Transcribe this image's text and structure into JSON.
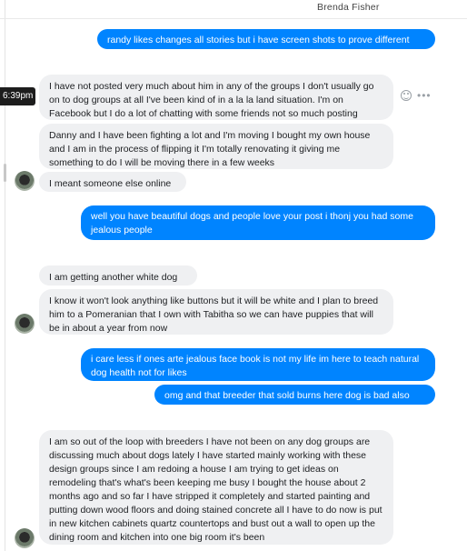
{
  "header": {
    "contact_name": "Brenda Fisher"
  },
  "timestamp": "6:39pm",
  "messages": [
    {
      "from": "me",
      "text": "randy likes changes all stories but i have screen shots to prove different"
    },
    {
      "from": "them",
      "text": "I have not posted very much about him in any of the groups I don't usually go on to dog groups at all I've been kind of in a la la land situation. I'm on Facebook but I do a lot of chatting with some friends not so much posting"
    },
    {
      "from": "them",
      "text": "Danny and I have been fighting a lot and I'm moving I bought my own house and I am in the process of flipping it I'm totally renovating it giving me something to do I will be moving there in a few weeks"
    },
    {
      "from": "them",
      "text": "I meant someone else online"
    },
    {
      "from": "me",
      "text": "well you have beautiful dogs and people love your post  i thonj you had some jealous people"
    },
    {
      "from": "them",
      "text": "I am getting another white dog"
    },
    {
      "from": "them",
      "text": "I know it won't look anything like buttons but it will be white and I plan to breed him to a Pomeranian that I own with Tabitha so we can have puppies that will be in about a year from now"
    },
    {
      "from": "me",
      "text": "i care less if ones arte jealous face book is not my life im here to teach natural dog health not for likes"
    },
    {
      "from": "me",
      "text": "omg and that breeder that sold burns here dog is bad also"
    },
    {
      "from": "them",
      "text": "I am so out of the loop with breeders I have not been on any dog groups are discussing much about dogs lately I have started mainly working with these design groups since I am redoing a house I am trying to get ideas on remodeling that's what's been keeping me busy I bought the house about 2 months ago and so far I have stripped it completely and started painting and putting down wood floors and doing stained concrete all I have to do now is put in new kitchen cabinets quartz countertops and bust out a wall to open up the dining room and kitchen into one big room it's been"
    }
  ]
}
